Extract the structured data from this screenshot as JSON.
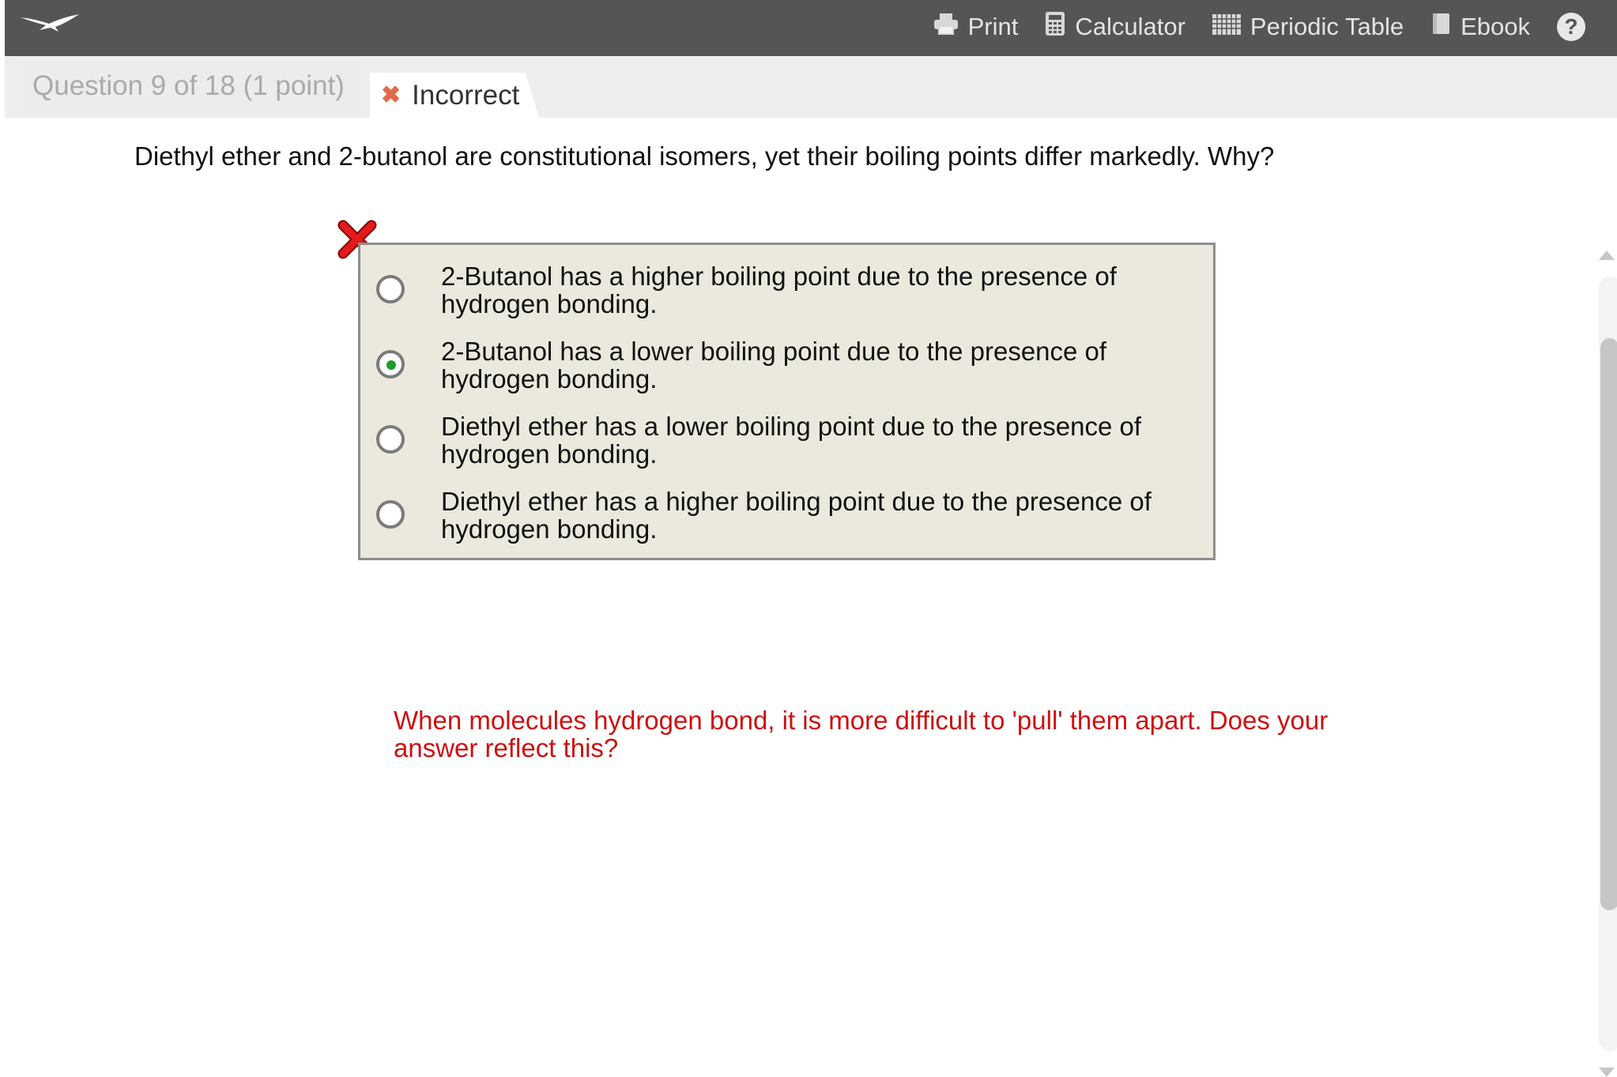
{
  "header": {
    "logo_icon": "bird-logo-icon",
    "tools": [
      {
        "label": "Print",
        "icon": "printer-icon"
      },
      {
        "label": "Calculator",
        "icon": "calculator-icon"
      },
      {
        "label": "Periodic Table",
        "icon": "periodic-table-icon"
      },
      {
        "label": "Ebook",
        "icon": "book-icon"
      }
    ],
    "help_label": "?"
  },
  "tabs": {
    "question_label": "Question 9 of 18 (1 point)",
    "status_label": "Incorrect",
    "status_icon": "x-icon",
    "status_color": "#e06a4a"
  },
  "question": {
    "text": "Diethyl ether and 2-butanol are constitutional isomers, yet their boiling points differ markedly. Why?"
  },
  "choices": [
    {
      "text": "2-Butanol has a higher boiling point due to the presence of hydrogen bonding.",
      "selected": false
    },
    {
      "text": "2-Butanol has a lower boiling point due to the presence of hydrogen bonding.",
      "selected": true
    },
    {
      "text": "Diethyl ether has a lower boiling point due to the presence of hydrogen bonding.",
      "selected": false
    },
    {
      "text": "Diethyl ether has a higher boiling point due to the presence of hydrogen bonding.",
      "selected": false
    }
  ],
  "feedback": {
    "text": "When molecules hydrogen bond, it is more difficult to 'pull' them apart. Does your answer reflect this?",
    "color": "#cc1111"
  },
  "colors": {
    "header_bg": "#555555",
    "choice_box_bg": "#ebe9dd",
    "selected_dot": "#1f9d2b"
  }
}
